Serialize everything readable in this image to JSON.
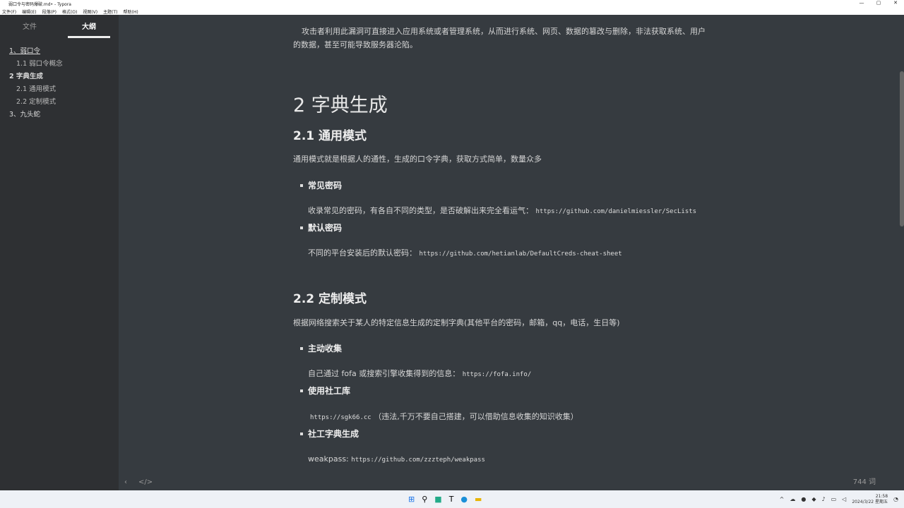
{
  "window": {
    "title": "弱口令与密码爆破.md• - Typora"
  },
  "menu": [
    "文件(F)",
    "编辑(E)",
    "段落(P)",
    "格式(O)",
    "视图(V)",
    "主题(T)",
    "帮助(H)"
  ],
  "sidebar": {
    "tabs": [
      "文件",
      "大纲"
    ],
    "outline": [
      "1、弱口令",
      "1.1 弱口令概念",
      "2 字典生成",
      "2.1 通用模式",
      "2.2 定制模式",
      "3、九头蛇"
    ]
  },
  "doc": {
    "intro": "攻击者利用此漏洞可直接进入应用系统或者管理系统，从而进行系统、网页、数据的篡改与删除，非法获取系统、用户",
    "intro2": "的数据，甚至可能导致服务器沦陷。",
    "h1": "2 字典生成",
    "h2a": "2.1 通用模式",
    "pa": "通用模式就是根据人的通性，生成的口令字典，获取方式简单，数量众多",
    "b1": "常见密码",
    "b1t": "收录常见的密码，有各自不同的类型，是否破解出来完全看运气：",
    "b1c": "https://github.com/danielmiessler/SecLists",
    "b2": "默认密码",
    "b2t": "不同的平台安装后的默认密码：",
    "b2c": "https://github.com/hetianlab/DefaultCreds-cheat-sheet",
    "h2b": "2.2 定制模式",
    "pb": "根据网络搜索关于某人的特定信息生成的定制字典(其他平台的密码，邮箱，qq，电话，生日等)",
    "b3": "主动收集",
    "b3t": "自己通过 fofa 或搜索引擎收集得到的信息：",
    "b3c": "https://fofa.info/",
    "b4": "使用社工库",
    "b4c": "https://sgk66.cc",
    "b4t": "（违法,千万不要自己搭建，可以借助信息收集的知识收集）",
    "b5": "社工字典生成",
    "b5t": "weakpass:",
    "b5c": "https://github.com/zzzteph/weakpass"
  },
  "footer": {
    "word_count": "744 词"
  },
  "tray": {
    "time": "21:58",
    "date": "2024/3/22 星期五"
  }
}
